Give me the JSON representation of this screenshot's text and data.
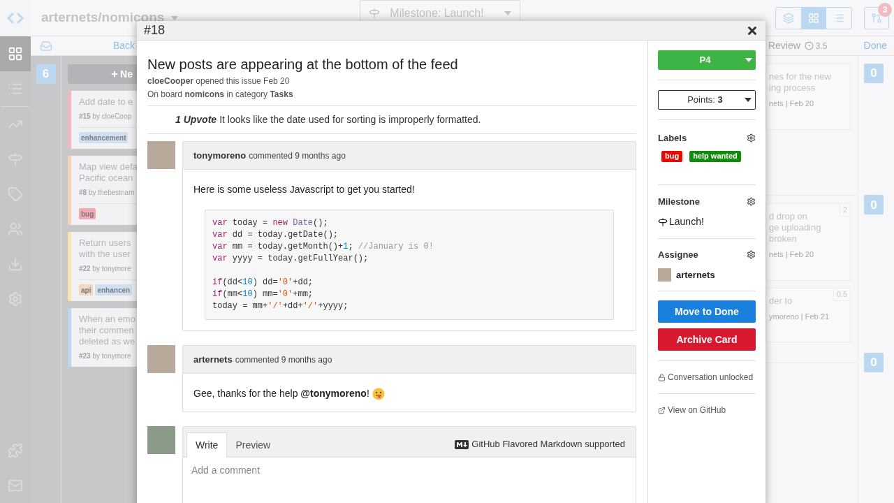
{
  "sidebar": {
    "items": [
      {
        "kind": "grid",
        "selected": true
      },
      {
        "kind": "list",
        "selected": false
      },
      {
        "kind": "chart",
        "selected": false
      },
      {
        "kind": "signpost",
        "selected": false
      },
      {
        "kind": "tag",
        "selected": false
      },
      {
        "kind": "people",
        "selected": false
      },
      {
        "kind": "download",
        "selected": false
      },
      {
        "kind": "settings",
        "selected": false
      }
    ],
    "bottom_items": [
      {
        "kind": "puzzle"
      },
      {
        "kind": "mail"
      }
    ]
  },
  "topbar": {
    "repo": "arternets/nomicons",
    "milestone_filter": "Milestone: Launch!",
    "view_buttons": [
      {
        "kind": "cards",
        "selected": false
      },
      {
        "kind": "grid",
        "selected": true
      },
      {
        "kind": "list",
        "selected": false
      }
    ],
    "notification_count": "3"
  },
  "backlog": {
    "header": "Back",
    "count": "6",
    "new_button": "Ne",
    "cards": [
      {
        "color": "#f2b8bf",
        "title_lines": [
          "Add date to e"
        ],
        "meta": "**#15** by cloeCoop",
        "tags": [
          {
            "name": "enhancement",
            "color": "#cfe0f2"
          }
        ]
      },
      {
        "color": "#f3d4b8",
        "title_lines": [
          "Map view defa",
          "Pacific ocean"
        ],
        "meta": "**#8** by thebestnam",
        "tags": [
          {
            "name": "bug",
            "color": "#f3a9b1"
          }
        ]
      },
      {
        "color": "#f7e6b0",
        "title_lines": [
          "Return users",
          "with the user"
        ],
        "meta": "**#22** by tonymore",
        "tags": [
          {
            "name": "api",
            "color": "#f3d8c0"
          },
          {
            "name": "enhancen",
            "color": "#cfe0f2"
          }
        ]
      },
      {
        "color": "#bcd7ef",
        "title_lines": [
          "When an emo",
          "their commen",
          "deleted as we"
        ],
        "meta": "**#23** by tonymore"
      }
    ]
  },
  "review": {
    "header": "Review",
    "points": "3.5",
    "sections": [
      {
        "cards": [
          {
            "title_lines": [
              "nes for the new",
              "ing process"
            ],
            "meta": "nets | Feb 20"
          }
        ]
      },
      {
        "cards": [
          {
            "title_lines": [
              "d drop on",
              "ge uploading",
              "broken"
            ],
            "meta": "nets | Feb 20",
            "points": "2"
          },
          {
            "title_lines": [
              "der to"
            ],
            "meta": "ymoreno | Feb 21",
            "points": "0.5"
          }
        ]
      }
    ]
  },
  "done": {
    "header": "Done",
    "counts": [
      "0",
      "0",
      "0"
    ]
  },
  "modal": {
    "number": "#18",
    "title": "New posts are appearing at the bottom of the feed",
    "opened_line": "**cloeCooper** opened this issue Feb 20",
    "board_line": "On board **nomicons** in category **Tasks**",
    "upvote_label": "1 Upvote",
    "description": "It looks like the date used for sorting is improperly formatted.",
    "comments": [
      {
        "author": "tonymoreno",
        "action": "commented 9 months ago",
        "text": "Here is some useless Javascript to get you started!",
        "code_groups": [
          [
            [
              {
                "kind": "kw",
                "t": "var"
              },
              {
                "kind": "p",
                "t": " today = "
              },
              {
                "kind": "kw",
                "t": "new "
              },
              {
                "kind": "type",
                "t": "Date"
              },
              {
                "kind": "p",
                "t": "();"
              }
            ],
            [
              {
                "kind": "kw",
                "t": "var"
              },
              {
                "kind": "p",
                "t": " dd = today.getDate();"
              }
            ],
            [
              {
                "kind": "kw",
                "t": "var"
              },
              {
                "kind": "p",
                "t": " mm = today.getMonth()+"
              },
              {
                "kind": "num",
                "t": "1"
              },
              {
                "kind": "p",
                "t": "; "
              },
              {
                "kind": "cm",
                "t": "//January is 0!"
              }
            ],
            [
              {
                "kind": "kw",
                "t": "var"
              },
              {
                "kind": "p",
                "t": " yyyy = today.getFullYear();"
              }
            ]
          ],
          [
            [
              {
                "kind": "kw",
                "t": "if"
              },
              {
                "kind": "p",
                "t": "(dd<"
              },
              {
                "kind": "num",
                "t": "10"
              },
              {
                "kind": "p",
                "t": ") dd="
              },
              {
                "kind": "str",
                "t": "'0'"
              },
              {
                "kind": "p",
                "t": "+dd;"
              }
            ],
            [
              {
                "kind": "kw",
                "t": "if"
              },
              {
                "kind": "p",
                "t": "(mm<"
              },
              {
                "kind": "num",
                "t": "10"
              },
              {
                "kind": "p",
                "t": ") mm="
              },
              {
                "kind": "str",
                "t": "'0'"
              },
              {
                "kind": "p",
                "t": "+mm;"
              }
            ],
            [
              {
                "kind": "p",
                "t": "today = mm+"
              },
              {
                "kind": "str",
                "t": "'/'"
              },
              {
                "kind": "p",
                "t": "+dd+"
              },
              {
                "kind": "str",
                "t": "'/'"
              },
              {
                "kind": "p",
                "t": "+yyyy;"
              }
            ]
          ]
        ]
      },
      {
        "author": "arternets",
        "action": "commented 9 months ago",
        "text": "Gee, thanks for the help **@tonymoreno**!",
        "emoji": true
      }
    ],
    "form": {
      "tabs": [
        {
          "label": "Write",
          "selected": true
        },
        {
          "label": "Preview",
          "selected": false
        }
      ],
      "note": "GitHub Flavored Markdown supported",
      "placeholder": "Add a comment"
    },
    "side": {
      "priority": "P4",
      "points": "Points: **3**",
      "labels_title": "Labels",
      "labels": [
        {
          "name": "bug",
          "color": "#ee0701"
        },
        {
          "name": "help wanted",
          "color": "#128a0c"
        }
      ],
      "milestone_title": "Milestone",
      "milestone": "Launch!",
      "assignee_title": "Assignee",
      "assignee": "arternets",
      "move_button": "Move to Done",
      "archive_button": "Archive Card",
      "conversation": "Conversation unlocked",
      "github_link": "View on GitHub"
    }
  }
}
